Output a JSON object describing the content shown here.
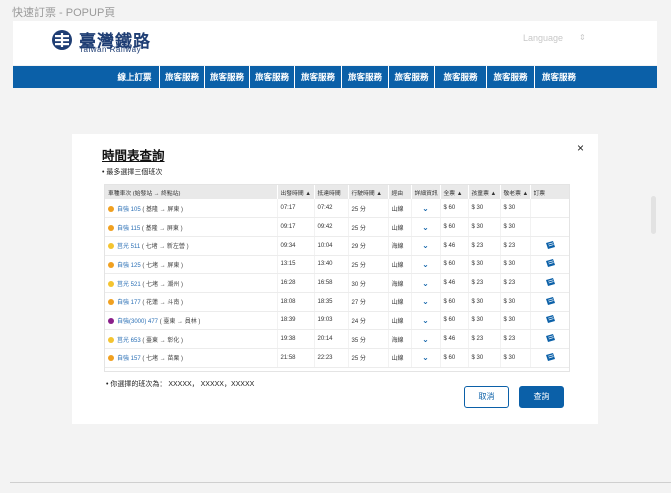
{
  "page": {
    "caption": "快速訂票 - POPUP頁"
  },
  "header": {
    "brand_cn": "臺灣鐵路",
    "brand_en": "Taiwan Railway",
    "language_label": "Language",
    "language_caret": "⇕"
  },
  "nav": {
    "items": [
      "線上訂票",
      "旅客服務",
      "旅客服務",
      "旅客服務",
      "旅客服務",
      "旅客服務",
      "旅客服務",
      "旅客服務",
      "旅客服務",
      "旅客服務"
    ]
  },
  "modal": {
    "title": "時間表查詢",
    "note": "• 最多選擇三個班次",
    "close": "×",
    "selected_text": "• 你選擇的班次為：  XXXXX，  XXXXX，XXXXX",
    "cancel_label": "取消",
    "query_label": "查詢"
  },
  "table": {
    "headers": [
      "車種車次 (始發站 → 終點站)",
      "出發時間 ▲",
      "抵達時間",
      "行駛時間 ▲",
      "經由",
      "詳細資訊",
      "全票 ▲",
      "孩童票 ▲",
      "敬老票 ▲",
      "訂票"
    ],
    "rows": [
      {
        "dot": "#f0a020",
        "train": "自強 105",
        "route": "( 基隆 → 屏東 )",
        "dep": "07:17",
        "arr": "07:42",
        "dur": "25 分",
        "via": "山線",
        "full": "$ 60",
        "child": "$ 30",
        "senior": "$ 30",
        "ticket": false
      },
      {
        "dot": "#f0a020",
        "train": "自強 115",
        "route": "( 基隆 → 屏東 )",
        "dep": "09:17",
        "arr": "09:42",
        "dur": "25 分",
        "via": "山線",
        "full": "$ 60",
        "child": "$ 30",
        "senior": "$ 30",
        "ticket": false
      },
      {
        "dot": "#f4c430",
        "train": "莒光 511",
        "route": "( 七堵 → 新左營 )",
        "dep": "09:34",
        "arr": "10:04",
        "dur": "29 分",
        "via": "海線",
        "full": "$ 46",
        "child": "$ 23",
        "senior": "$ 23",
        "ticket": true
      },
      {
        "dot": "#f0a020",
        "train": "自強 125",
        "route": "( 七堵 → 屏東 )",
        "dep": "13:15",
        "arr": "13:40",
        "dur": "25 分",
        "via": "山線",
        "full": "$ 60",
        "child": "$ 30",
        "senior": "$ 30",
        "ticket": true
      },
      {
        "dot": "#f4c430",
        "train": "莒光 521",
        "route": "( 七堵 → 潮州 )",
        "dep": "16:28",
        "arr": "16:58",
        "dur": "30 分",
        "via": "海線",
        "full": "$ 46",
        "child": "$ 23",
        "senior": "$ 23",
        "ticket": true
      },
      {
        "dot": "#f0a020",
        "train": "自強 177",
        "route": "( 花蓮 → 斗南 )",
        "dep": "18:08",
        "arr": "18:35",
        "dur": "27 分",
        "via": "山線",
        "full": "$ 60",
        "child": "$ 30",
        "senior": "$ 30",
        "ticket": true
      },
      {
        "dot": "#8a1f8a",
        "train": "自強(3000) 477",
        "route": "( 臺東 → 員林 )",
        "dep": "18:39",
        "arr": "19:03",
        "dur": "24 分",
        "via": "山線",
        "full": "$ 60",
        "child": "$ 30",
        "senior": "$ 30",
        "ticket": true
      },
      {
        "dot": "#f4c430",
        "train": "莒光 653",
        "route": "( 臺東 → 彰化 )",
        "dep": "19:38",
        "arr": "20:14",
        "dur": "35 分",
        "via": "海線",
        "full": "$ 46",
        "child": "$ 23",
        "senior": "$ 23",
        "ticket": true
      },
      {
        "dot": "#f0a020",
        "train": "自強 157",
        "route": "( 七堵 → 苗栗 )",
        "dep": "21:58",
        "arr": "22:23",
        "dur": "25 分",
        "via": "山線",
        "full": "$ 60",
        "child": "$ 30",
        "senior": "$ 30",
        "ticket": true
      }
    ]
  },
  "colors": {
    "brand_blue": "#0b60a8",
    "logo_navy": "#1f3e74"
  }
}
